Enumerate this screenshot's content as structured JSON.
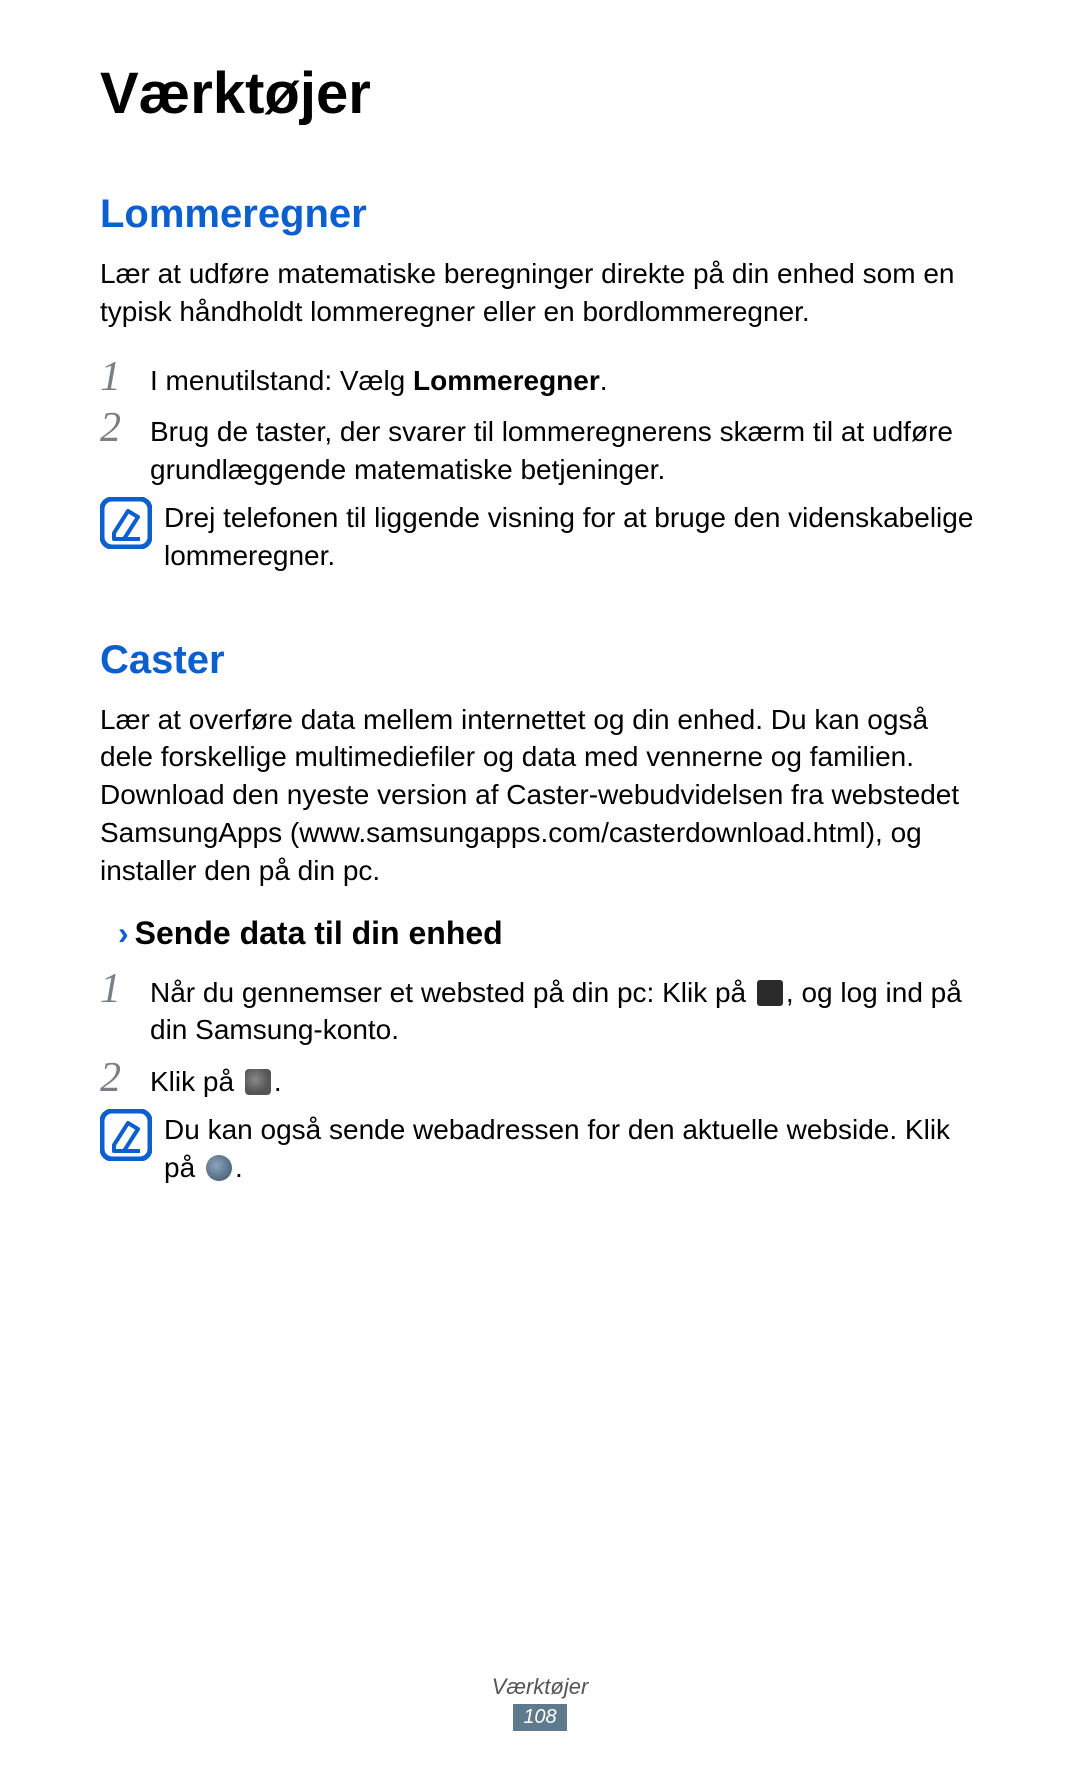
{
  "title": "Værktøjer",
  "calc": {
    "heading": "Lommeregner",
    "intro": "Lær at udføre matematiske beregninger direkte på din enhed som en typisk håndholdt lommeregner eller en bordlommeregner.",
    "step1_prefix": "I menutilstand: Vælg ",
    "step1_bold": "Lommeregner",
    "step1_suffix": ".",
    "step2": "Brug de taster, der svarer til lommeregnerens skærm til at udføre grundlæggende matematiske betjeninger.",
    "note": "Drej telefonen til liggende visning for at bruge den videnskabelige lommeregner."
  },
  "caster": {
    "heading": "Caster",
    "intro": "Lær at overføre data mellem internettet og din enhed. Du kan også dele forskellige multimediefiler og data med vennerne og familien. Download den nyeste version af Caster-webudvidelsen fra webstedet SamsungApps (www.samsungapps.com/casterdownload.html), og installer den på din pc.",
    "sub_heading": "Sende data til din enhed",
    "step1_a": "Når du gennemser et websted på din pc: Klik på ",
    "step1_b": ", og log ind på din Samsung-konto.",
    "step2_a": "Klik på ",
    "step2_b": ".",
    "note_a": "Du kan også sende webadressen for den aktuelle webside. Klik på ",
    "note_b": "."
  },
  "nums": {
    "one": "1",
    "two": "2"
  },
  "chevron": "›",
  "footer": {
    "section": "Værktøjer",
    "page": "108"
  }
}
